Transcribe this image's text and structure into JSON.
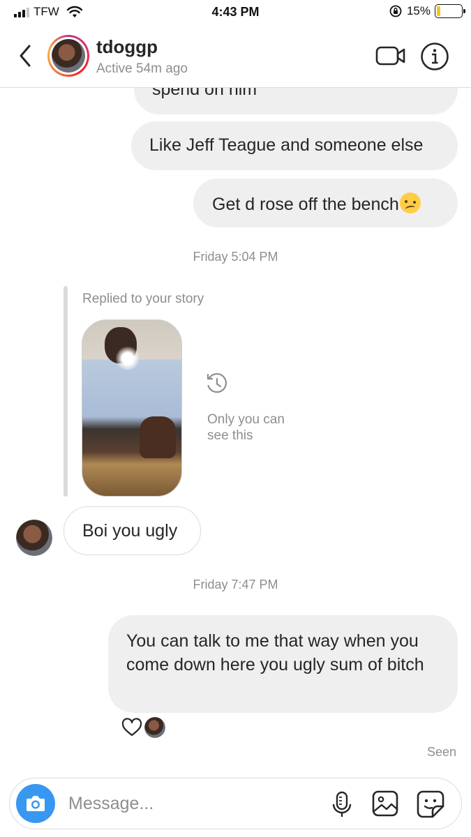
{
  "status_bar": {
    "carrier": "TFW",
    "time": "4:43 PM",
    "battery_percent": "15%",
    "battery_level": 0.15,
    "battery_color": "#f6c41a"
  },
  "header": {
    "username": "tdoggp",
    "status": "Active 54m ago",
    "icons": [
      "back-chevron-icon",
      "video-call-icon",
      "info-icon"
    ]
  },
  "messages": {
    "partial_top": "spend on him",
    "outgoing_1": "Like Jeff Teague and someone else",
    "outgoing_2": "Get d rose off the bench",
    "timestamp_1": "Friday 5:04 PM",
    "reply_label": "Replied to your story",
    "story_note": "Only you can see this",
    "incoming_1": "Boi you ugly",
    "timestamp_2": "Friday 7:47 PM",
    "outgoing_3": "You can talk to me that way when you come down here you ugly sum of bitch",
    "seen": "Seen"
  },
  "composer": {
    "placeholder": "Message...",
    "accent_color": "#3897f0",
    "icons": [
      "camera-icon",
      "microphone-icon",
      "gallery-icon",
      "sticker-icon"
    ]
  }
}
